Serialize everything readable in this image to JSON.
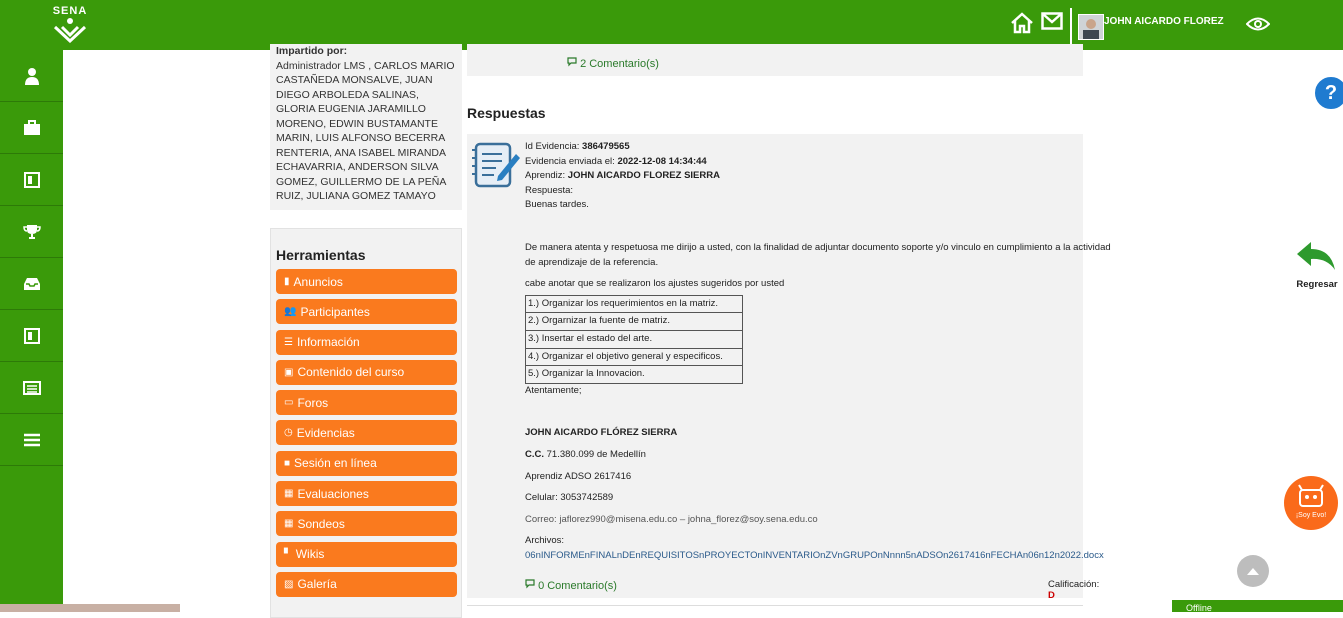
{
  "header": {
    "logo_text": "SENA",
    "user_name": "JOHN AICARDO FLOREZ",
    "icons": [
      "home-icon",
      "mail-icon",
      "eye-icon"
    ]
  },
  "sidebar": {
    "icons": [
      "user-icon",
      "briefcase-icon",
      "calendar-icon",
      "trophy-icon",
      "inbox-icon",
      "book-icon",
      "list-icon",
      "menu-icon"
    ]
  },
  "course_info": {
    "imparted_label": "Impartido por:",
    "instructors": "Administrador LMS , CARLOS MARIO CASTAÑEDA MONSALVE, JUAN DIEGO ARBOLEDA SALINAS, GLORIA EUGENIA JARAMILLO MORENO, EDWIN BUSTAMANTE MARIN, LUIS ALFONSO BECERRA RENTERIA, ANA ISABEL MIRANDA ECHAVARRIA, ANDERSON SILVA GOMEZ, GUILLERMO DE LA PEÑA RUIZ, JULIANA GOMEZ TAMAYO"
  },
  "tools": {
    "title": "Herramientas",
    "items": [
      {
        "label": "Anuncios",
        "icon": "▮"
      },
      {
        "label": "Participantes",
        "icon": "👥"
      },
      {
        "label": "Información",
        "icon": "☰"
      },
      {
        "label": "Contenido del curso",
        "icon": "▣"
      },
      {
        "label": "Foros",
        "icon": "▭"
      },
      {
        "label": "Evidencias",
        "icon": "◷"
      },
      {
        "label": "Sesión en línea",
        "icon": "■"
      },
      {
        "label": "Evaluaciones",
        "icon": "▦"
      },
      {
        "label": "Sondeos",
        "icon": "▦"
      },
      {
        "label": "Wikis",
        "icon": "▘"
      },
      {
        "label": "Galería",
        "icon": "▨"
      }
    ]
  },
  "top_comments": "2 Comentario(s)",
  "responses": {
    "title": "Respuestas",
    "evidence_id_label": "Id Evidencia:",
    "evidence_id": "386479565",
    "sent_label": "Evidencia enviada el:",
    "sent_date": "2022-12-08 14:34:44",
    "learner_label": "Aprendiz:",
    "learner": "JOHN AICARDO FLOREZ SIERRA",
    "answer_label": "Respuesta:",
    "greeting": "Buenas tardes.",
    "paragraph": "De manera atenta y respetuosa me dirijo a usted, con la finalidad de adjuntar documento soporte y/o vinculo en cumplimiento a la actividad de aprendizaje de la referencia.",
    "note": "cabe anotar que se realizaron los ajustes sugeridos por usted",
    "list": [
      "1.) Organizar los requerimientos en la matriz.",
      "2.) Orgarnizar la fuente de matriz.",
      "3.) Insertar el estado del arte.",
      "4.) Organizar el objetivo general y especificos.",
      "5.) Organizar la Innovacion."
    ],
    "closing": "Atentamente;",
    "signature_name": "JOHN AICARDO FLÓREZ SIERRA",
    "cc_label": "C.C.",
    "cc_value": "71.380.099 de Medellín",
    "program": "Aprendiz ADSO 2617416",
    "phone": "Celular: 3053742589",
    "email_label": "Correo:",
    "email1": "jaflorez990@misena.edu.co",
    "email_sep": "–",
    "email2": "johna_florez@soy.sena.edu.co",
    "files_label": "Archivos:",
    "file_name": "06nINFORMEnFINALnDEnREQUISITOSnPROYECTOnINVENTARIOnZVnGRUPOnNnnn5nADSOn2617416nFECHAn06n12n2022.docx",
    "comments": "0 Comentario(s)",
    "grade_label": "Calificación:",
    "grade": "D"
  },
  "floating": {
    "help": "?",
    "back_label": "Regresar",
    "evo_label": "¡Soy Evo!",
    "offline_label": "Offline"
  },
  "colors": {
    "brand_green": "#3a9a0a",
    "tool_orange": "#fa7a1e",
    "link_green": "#2a7a2a",
    "grade_red": "#cc0000"
  }
}
